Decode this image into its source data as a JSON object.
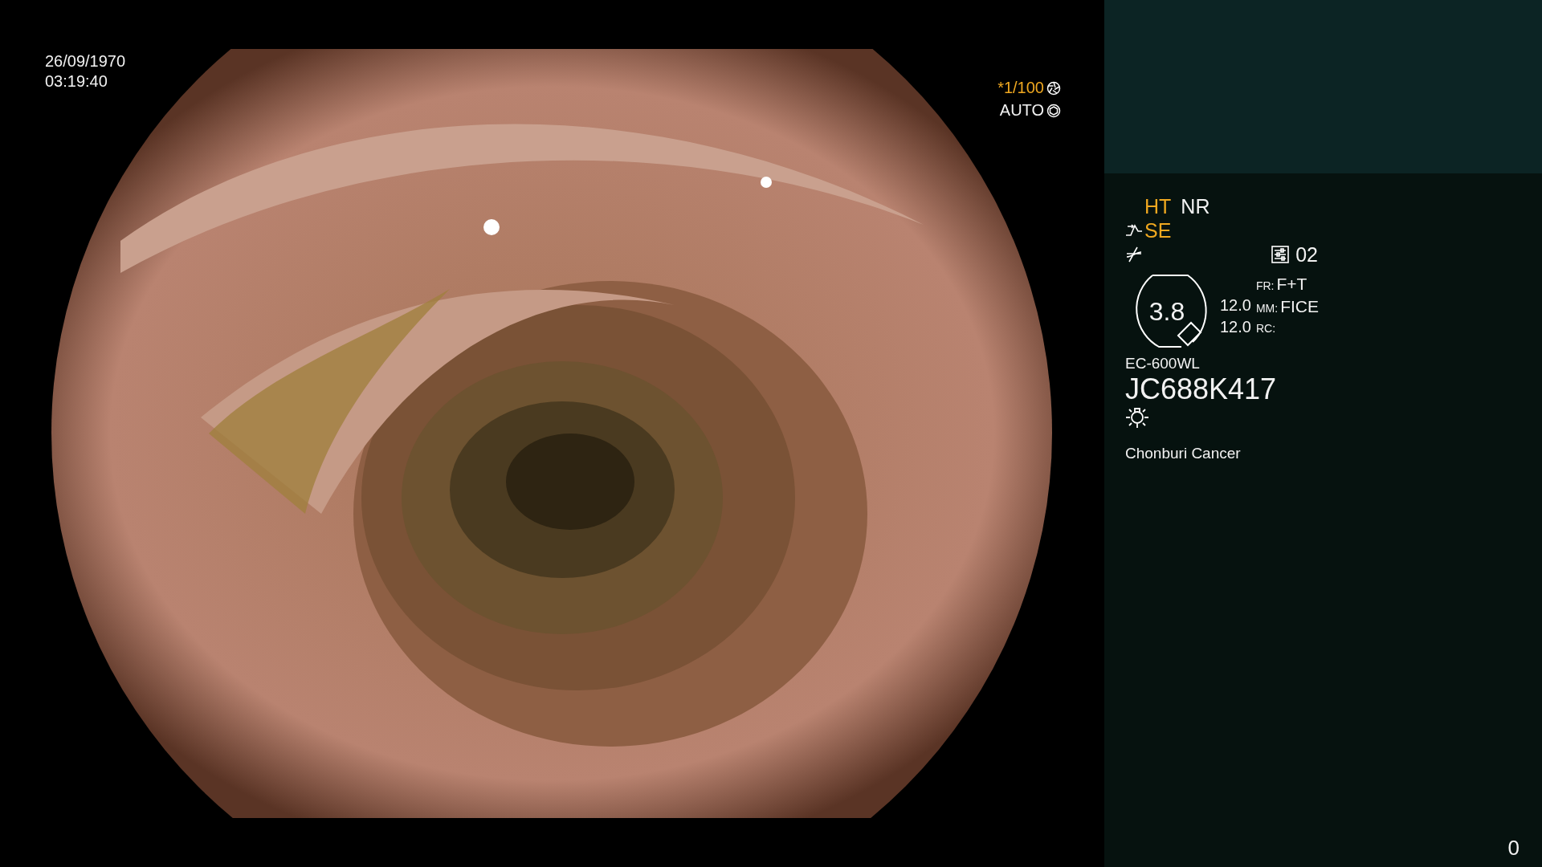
{
  "timestamp": {
    "date": "26/09/1970",
    "time": "03:19:40"
  },
  "exposure": [
    {
      "text": "*1/100",
      "highlighted": true,
      "kind": "shutter"
    },
    {
      "text": "AUTO",
      "highlighted": false,
      "kind": "iris"
    }
  ],
  "panel": {
    "modes": [
      {
        "label": "HT",
        "highlighted": true
      },
      {
        "label": "NR",
        "highlighted": false
      }
    ],
    "enhancement": {
      "label": "SE",
      "highlighted": true
    },
    "preset": "02",
    "zoom": "3.8",
    "readings": [
      "12.0",
      "12.0"
    ],
    "settings": [
      {
        "key": "FR:",
        "value": "F+T"
      },
      {
        "key": "MM:",
        "value": "FICE"
      },
      {
        "key": "RC:"
      }
    ],
    "scope_model": "EC-600WL",
    "serial": "JC688K417",
    "hospital": "Chonburi Cancer"
  },
  "counter": "0"
}
